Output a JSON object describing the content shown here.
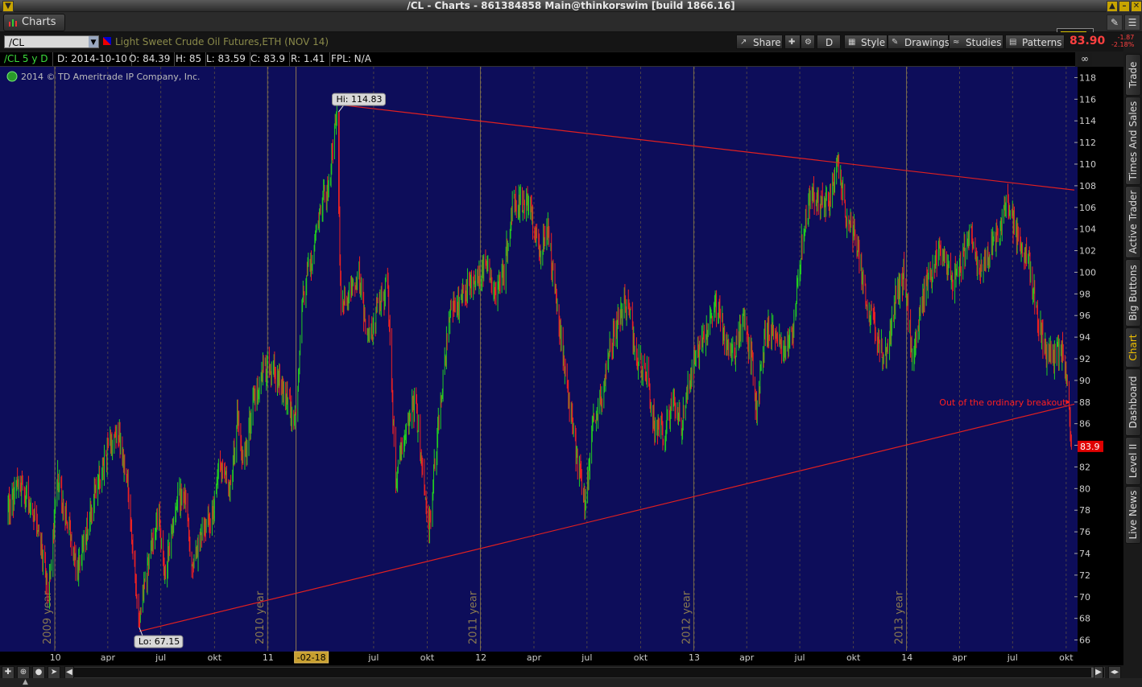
{
  "window": {
    "title": "/CL - Charts - 861384858 Main@thinkorswim [build 1866.16]"
  },
  "tab": {
    "label": "Charts"
  },
  "toolbar": {
    "symbol": "/CL",
    "description": "Light Sweet Crude Oil Futures,ETH (NOV 14)",
    "buttons": {
      "share": "Share",
      "drawing_mode": "D",
      "style": "Style",
      "drawings": "Drawings",
      "studies": "Studies",
      "patterns": "Patterns"
    },
    "last_price": "83.90",
    "change_abs": "-1.87",
    "change_pct": "-2.18%"
  },
  "infobar": {
    "period": "/CL 5 y D",
    "date": "D: 2014-10-10",
    "open": "O: 84.39",
    "high": "H: 85",
    "low": "L: 83.59",
    "close": "C: 83.9",
    "range": "R: 1.41",
    "fpl": "FPL: N/A"
  },
  "copyright": "2014 © TD Ameritrade IP Company, Inc.",
  "sidebar": {
    "tabs": [
      "Trade",
      "Times And Sales",
      "Active Trader",
      "Big Buttons",
      "Chart",
      "Dashboard",
      "Level II",
      "Live News"
    ],
    "active": "Chart"
  },
  "colors": {
    "background": "#0d0d5a",
    "up": "#22cc22",
    "down": "#ee2222",
    "trendline": "#e02020",
    "grid": "#7a6a3a",
    "annotation": "#ff2020"
  },
  "chart_data": {
    "type": "candlestick",
    "ylim": [
      65,
      119
    ],
    "y_ticks": [
      66,
      68,
      70,
      72,
      74,
      76,
      78,
      80,
      82,
      84,
      86,
      88,
      90,
      92,
      94,
      96,
      98,
      100,
      102,
      104,
      106,
      108,
      110,
      112,
      114,
      116,
      118
    ],
    "x_tick_labels": [
      "10",
      "apr",
      "jul",
      "okt",
      "11",
      "-02-18",
      "jul",
      "okt",
      "12",
      "apr",
      "jul",
      "okt",
      "13",
      "apr",
      "jul",
      "okt",
      "14",
      "apr",
      "jul",
      "okt"
    ],
    "x_tick_dates": [
      "2010-01-01",
      "2010-04-01",
      "2010-07-01",
      "2010-10-01",
      "2011-01-01",
      "2011-02-18",
      "2011-07-01",
      "2011-10-01",
      "2012-01-01",
      "2012-04-01",
      "2012-07-01",
      "2012-10-01",
      "2013-01-01",
      "2013-04-01",
      "2013-07-01",
      "2013-10-01",
      "2014-01-01",
      "2014-04-01",
      "2014-07-01",
      "2014-10-01"
    ],
    "highlighted_x_label": "-02-18",
    "year_separators": [
      "2009 year",
      "2010 year",
      "2011 year",
      "2012 year",
      "2013 year"
    ],
    "year_separator_dates": [
      "2009-12-31",
      "2010-12-31",
      "2011-12-31",
      "2012-12-31",
      "2013-12-31"
    ],
    "x_range": [
      "2009-10-05",
      "2014-10-15"
    ],
    "price_path": [
      [
        "2009-10-12",
        78
      ],
      [
        "2009-10-28",
        80
      ],
      [
        "2009-11-15",
        79
      ],
      [
        "2009-12-05",
        76
      ],
      [
        "2009-12-20",
        70
      ],
      [
        "2010-01-05",
        81
      ],
      [
        "2010-01-25",
        76
      ],
      [
        "2010-02-08",
        72
      ],
      [
        "2010-03-01",
        78
      ],
      [
        "2010-03-20",
        81
      ],
      [
        "2010-04-05",
        84
      ],
      [
        "2010-04-20",
        85
      ],
      [
        "2010-05-05",
        80
      ],
      [
        "2010-05-25",
        68
      ],
      [
        "2010-06-10",
        73
      ],
      [
        "2010-06-25",
        78
      ],
      [
        "2010-07-08",
        72
      ],
      [
        "2010-07-25",
        78
      ],
      [
        "2010-08-10",
        80
      ],
      [
        "2010-08-25",
        72
      ],
      [
        "2010-09-10",
        76
      ],
      [
        "2010-09-25",
        77
      ],
      [
        "2010-10-10",
        82
      ],
      [
        "2010-10-28",
        80
      ],
      [
        "2010-11-10",
        87
      ],
      [
        "2010-11-20",
        82
      ],
      [
        "2010-12-05",
        88
      ],
      [
        "2010-12-25",
        91
      ],
      [
        "2011-01-10",
        91
      ],
      [
        "2011-01-28",
        89
      ],
      [
        "2011-02-10",
        87
      ],
      [
        "2011-02-18",
        86
      ],
      [
        "2011-03-01",
        98
      ],
      [
        "2011-03-15",
        101
      ],
      [
        "2011-03-31",
        106
      ],
      [
        "2011-04-15",
        108
      ],
      [
        "2011-04-29",
        114.8
      ],
      [
        "2011-05-06",
        97
      ],
      [
        "2011-05-20",
        98
      ],
      [
        "2011-06-05",
        100
      ],
      [
        "2011-06-20",
        94
      ],
      [
        "2011-07-05",
        96
      ],
      [
        "2011-07-25",
        99
      ],
      [
        "2011-08-08",
        80
      ],
      [
        "2011-08-25",
        86
      ],
      [
        "2011-09-10",
        88
      ],
      [
        "2011-09-25",
        81
      ],
      [
        "2011-10-04",
        76
      ],
      [
        "2011-10-20",
        86
      ],
      [
        "2011-11-10",
        97
      ],
      [
        "2011-11-25",
        97
      ],
      [
        "2011-12-10",
        99
      ],
      [
        "2011-12-25",
        99
      ],
      [
        "2012-01-10",
        101
      ],
      [
        "2012-01-25",
        98
      ],
      [
        "2012-02-10",
        100
      ],
      [
        "2012-02-25",
        107
      ],
      [
        "2012-03-10",
        106
      ],
      [
        "2012-03-25",
        106
      ],
      [
        "2012-04-10",
        102
      ],
      [
        "2012-04-25",
        104
      ],
      [
        "2012-05-10",
        97
      ],
      [
        "2012-05-25",
        91
      ],
      [
        "2012-06-10",
        84
      ],
      [
        "2012-06-28",
        78
      ],
      [
        "2012-07-10",
        86
      ],
      [
        "2012-07-25",
        88
      ],
      [
        "2012-08-10",
        93
      ],
      [
        "2012-08-25",
        96
      ],
      [
        "2012-09-10",
        97
      ],
      [
        "2012-09-25",
        92
      ],
      [
        "2012-10-10",
        91
      ],
      [
        "2012-10-25",
        86
      ],
      [
        "2012-11-10",
        85
      ],
      [
        "2012-11-25",
        88
      ],
      [
        "2012-12-10",
        86
      ],
      [
        "2012-12-28",
        91
      ],
      [
        "2013-01-10",
        93
      ],
      [
        "2013-01-25",
        95
      ],
      [
        "2013-02-10",
        97
      ],
      [
        "2013-02-25",
        93
      ],
      [
        "2013-03-10",
        92
      ],
      [
        "2013-03-25",
        96
      ],
      [
        "2013-04-10",
        92
      ],
      [
        "2013-04-18",
        87
      ],
      [
        "2013-05-05",
        95
      ],
      [
        "2013-05-20",
        94
      ],
      [
        "2013-06-05",
        93
      ],
      [
        "2013-06-20",
        95
      ],
      [
        "2013-07-05",
        103
      ],
      [
        "2013-07-20",
        107
      ],
      [
        "2013-08-05",
        106
      ],
      [
        "2013-08-25",
        107
      ],
      [
        "2013-09-05",
        110
      ],
      [
        "2013-09-20",
        105
      ],
      [
        "2013-10-05",
        103
      ],
      [
        "2013-10-25",
        97
      ],
      [
        "2013-11-10",
        94
      ],
      [
        "2013-11-27",
        92
      ],
      [
        "2013-12-10",
        97
      ],
      [
        "2013-12-27",
        100
      ],
      [
        "2014-01-10",
        92
      ],
      [
        "2014-01-25",
        97
      ],
      [
        "2014-02-10",
        100
      ],
      [
        "2014-02-28",
        102
      ],
      [
        "2014-03-10",
        101
      ],
      [
        "2014-03-20",
        99
      ],
      [
        "2014-04-05",
        101
      ],
      [
        "2014-04-20",
        104
      ],
      [
        "2014-05-05",
        100
      ],
      [
        "2014-05-20",
        102
      ],
      [
        "2014-06-10",
        104
      ],
      [
        "2014-06-20",
        107
      ],
      [
        "2014-07-05",
        104
      ],
      [
        "2014-07-25",
        102
      ],
      [
        "2014-08-10",
        97
      ],
      [
        "2014-08-25",
        93
      ],
      [
        "2014-09-10",
        92
      ],
      [
        "2014-09-25",
        93
      ],
      [
        "2014-10-05",
        89
      ],
      [
        "2014-10-10",
        83.9
      ]
    ],
    "high": {
      "date": "2011-05-02",
      "value": 114.83,
      "label": "Hi: 114.83"
    },
    "low": {
      "date": "2010-05-25",
      "value": 67.15,
      "label": "Lo: 67.15"
    },
    "trendlines": [
      {
        "from": [
          "2011-05-02",
          115.5
        ],
        "to": [
          "2014-10-15",
          107.6
        ]
      },
      {
        "from": [
          "2010-05-25",
          66.8
        ],
        "to": [
          "2014-10-15",
          87.8
        ]
      }
    ],
    "annotation": {
      "text": "Out of the ordinary breakout",
      "date": "2014-10-06",
      "value": 88
    },
    "last_label": "83.9"
  }
}
